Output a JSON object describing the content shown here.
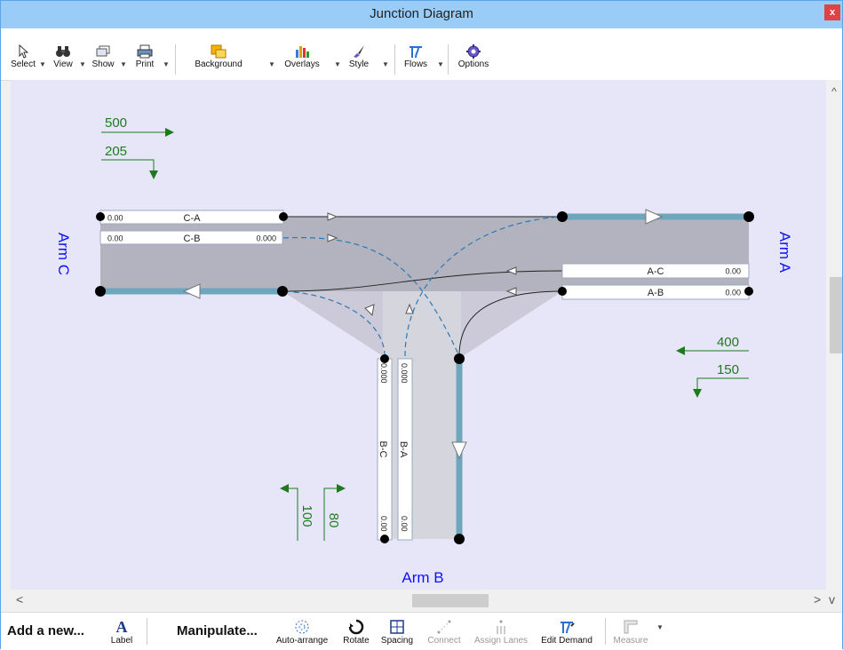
{
  "window": {
    "title": "Junction Diagram",
    "close_label": "x"
  },
  "toolbar": {
    "items": [
      {
        "label": "Select",
        "icon": "cursor-icon"
      },
      {
        "label": "View",
        "icon": "binoculars-icon"
      },
      {
        "label": "Show",
        "icon": "layers-icon"
      },
      {
        "label": "Print",
        "icon": "printer-icon"
      },
      {
        "label": "Background",
        "icon": "background-icon"
      },
      {
        "label": "Overlays",
        "icon": "bar-chart-icon"
      },
      {
        "label": "Style",
        "icon": "brush-icon"
      },
      {
        "label": "Flows",
        "icon": "flows-icon"
      },
      {
        "label": "Options",
        "icon": "gear-icon"
      }
    ],
    "dropdown_glyph": "▼"
  },
  "diagram": {
    "arms": {
      "a": "Arm A",
      "b": "Arm B",
      "c": "Arm C"
    },
    "arm_c_flows": {
      "straight": "500",
      "turn": "205"
    },
    "arm_a_flows": {
      "straight": "400",
      "turn": "150"
    },
    "arm_b_flows": {
      "left": "100",
      "right": "80"
    },
    "lanes": {
      "ca": {
        "name": "C-A",
        "value": "0.00"
      },
      "cb": {
        "name": "C-B",
        "value": "0.00",
        "value2": "0.000"
      },
      "ac": {
        "name": "A-C",
        "value": "0.00"
      },
      "ab": {
        "name": "A-B",
        "value": "0.00"
      },
      "bc": {
        "name": "B-C",
        "top": "0.000",
        "bottom": "0.00"
      },
      "ba": {
        "name": "B-A",
        "top": "0.000",
        "bottom": "0.00"
      }
    },
    "colors": {
      "flow_text": "#1f7a1f",
      "arm_label": "#1010ff",
      "road": "#b3b3bf",
      "lane_edge": "#6da6bd"
    }
  },
  "scroll": {
    "left": "<",
    "right": ">",
    "up": "^",
    "down": "v"
  },
  "bottombar": {
    "add_label": "Add a new...",
    "label_button": "Label",
    "label_glyph": "A",
    "manipulate_label": "Manipulate...",
    "tools": [
      {
        "label": "Auto-arrange",
        "icon": "auto-arrange-icon",
        "enabled": true
      },
      {
        "label": "Rotate",
        "icon": "rotate-icon",
        "enabled": true
      },
      {
        "label": "Spacing",
        "icon": "spacing-icon",
        "enabled": true
      },
      {
        "label": "Connect",
        "icon": "connect-icon",
        "enabled": false
      },
      {
        "label": "Assign Lanes",
        "icon": "assign-lanes-icon",
        "enabled": false
      },
      {
        "label": "Edit Demand",
        "icon": "edit-demand-icon",
        "enabled": true
      },
      {
        "label": "Measure",
        "icon": "measure-icon",
        "enabled": false
      }
    ]
  }
}
